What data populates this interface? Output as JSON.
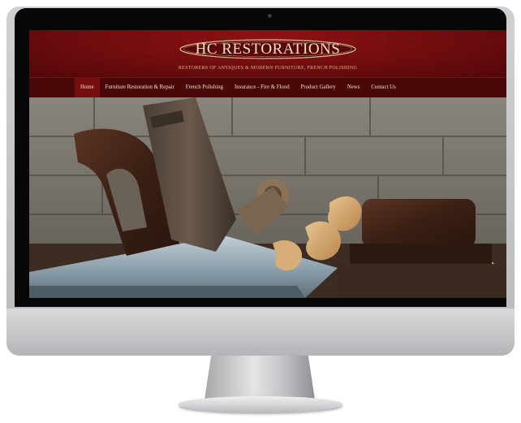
{
  "site": {
    "logo_text": "HC RESTORATIONS",
    "tagline": "Restorers of Antiques & Modern Furniture, French Polishing"
  },
  "nav": {
    "items": [
      {
        "label": "Home",
        "active": true
      },
      {
        "label": "Furniture Restoration & Repair",
        "active": false
      },
      {
        "label": "French Polishing",
        "active": false
      },
      {
        "label": "Insurance - Fire & Flood",
        "active": false
      },
      {
        "label": "Product Gallery",
        "active": false
      },
      {
        "label": "News",
        "active": false
      },
      {
        "label": "Contact Us",
        "active": false
      }
    ]
  },
  "hero": {
    "subject": "vintage wood plane with curled wood shavings"
  },
  "colors": {
    "header_red": "#6b0c0e",
    "nav_dark": "#4a0708",
    "nav_active": "#760e10",
    "text_cream": "#f1e4c8"
  }
}
